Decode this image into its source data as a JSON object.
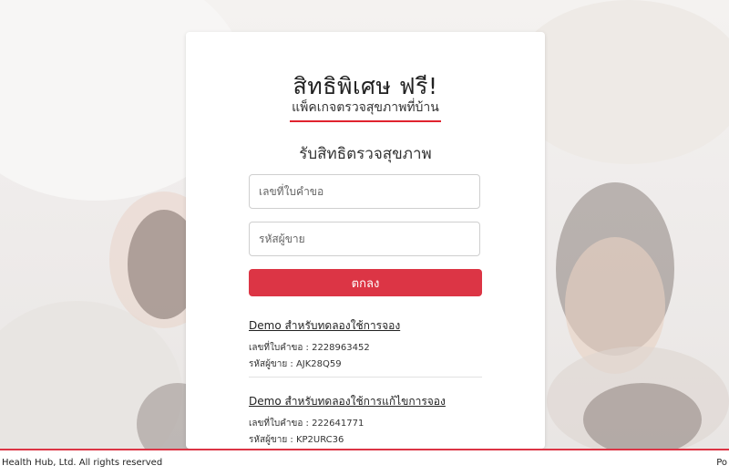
{
  "card": {
    "headline": "สิทธิพิเศษ ฟรี!",
    "subline": "แพ็คเกจตรวจสุขภาพที่บ้าน",
    "form_title": "รับสิทธิตรวจสุขภาพ",
    "fields": {
      "request_no_placeholder": "เลขที่ใบคำขอ",
      "seller_code_placeholder": "รหัสผู้ขาย"
    },
    "submit_label": "ตกลง",
    "demos": [
      {
        "title": "Demo สำหรับทดลองใช้การจอง",
        "request_line": "เลขที่ใบคำขอ : 2228963452",
        "seller_line": "รหัสผู้ขาย : AJK28Q59"
      },
      {
        "title": "Demo สำหรับทดลองใช้การแก้ไขการจอง",
        "request_line": "เลขที่ใบคำขอ : 222641771",
        "seller_line": "รหัสผู้ขาย : KP2URC36"
      }
    ]
  },
  "footer": {
    "copyright": "Health Hub, Ltd. All rights reserved",
    "right_text": "Po"
  },
  "colors": {
    "accent": "#dc3545",
    "underline": "#e0242f"
  }
}
